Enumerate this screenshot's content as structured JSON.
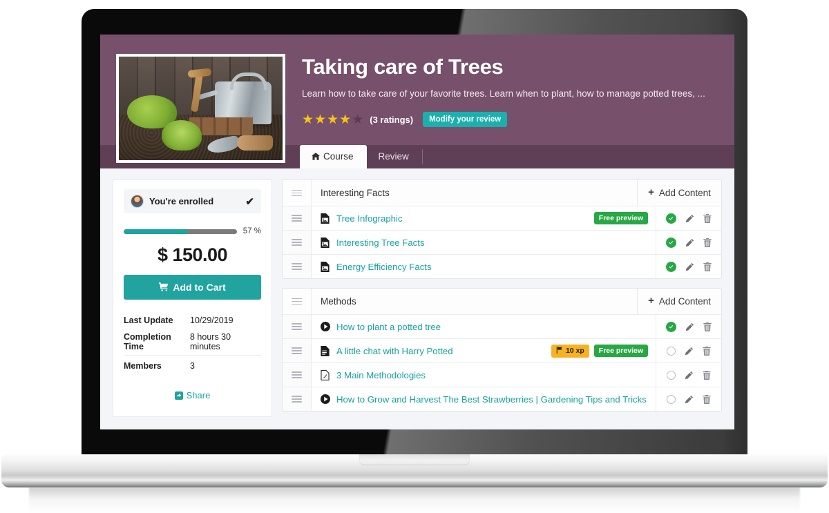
{
  "hero": {
    "title": "Taking care of Trees",
    "description": "Learn how to take care of your favorite trees. Learn when to plant, how to manage potted trees, ...",
    "rating_value": 4,
    "rating_max": 5,
    "rating_count_label": "(3 ratings)",
    "modify_review_label": "Modify your review",
    "thumbnail_alt": "gardening-tools-photo",
    "bg_color": "#77506b"
  },
  "tabs": [
    {
      "label": "Course",
      "icon": "home-icon",
      "active": true
    },
    {
      "label": "Review",
      "icon": "",
      "active": false
    }
  ],
  "sidebar": {
    "enrolled_text": "You're enrolled",
    "enrolled_check": "✔",
    "progress_percent": 57,
    "progress_label": "57 %",
    "price": "$ 150.00",
    "add_to_cart_label": "Add to Cart",
    "meta": [
      {
        "key": "Last Update",
        "value": "10/29/2019"
      },
      {
        "key": "Completion Time",
        "value": "8 hours 30 minutes"
      },
      {
        "key": "Members",
        "value": "3"
      }
    ],
    "share_label": "Share",
    "accent_color": "#21a3a0"
  },
  "content": {
    "add_content_label": "Add Content",
    "sections": [
      {
        "title": "Interesting Facts",
        "rows": [
          {
            "title": "Tree Infographic",
            "icon": "image-file-icon",
            "badges": [
              {
                "type": "free",
                "label": "Free preview"
              }
            ],
            "completed": true
          },
          {
            "title": "Interesting Tree Facts",
            "icon": "image-file-icon",
            "badges": [],
            "completed": true
          },
          {
            "title": "Energy Efficiency Facts",
            "icon": "image-file-icon",
            "badges": [],
            "completed": true
          }
        ]
      },
      {
        "title": "Methods",
        "rows": [
          {
            "title": "How to plant a potted tree",
            "icon": "video-play-icon",
            "badges": [],
            "completed": true
          },
          {
            "title": "A little chat with Harry Potted",
            "icon": "document-icon",
            "badges": [
              {
                "type": "xp",
                "label": "10 xp"
              },
              {
                "type": "free",
                "label": "Free preview"
              }
            ],
            "completed": false
          },
          {
            "title": "3 Main Methodologies",
            "icon": "pdf-file-icon",
            "badges": [],
            "completed": false
          },
          {
            "title": "How to Grow and Harvest The Best Strawberries | Gardening Tips and Tricks",
            "icon": "video-play-icon",
            "badges": [],
            "completed": false
          }
        ]
      }
    ],
    "action_icons": {
      "complete": "check-circle-icon",
      "edit": "pencil-icon",
      "delete": "trash-icon"
    },
    "badge_colors": {
      "free": "#27a844",
      "xp": "#f5b324"
    }
  }
}
